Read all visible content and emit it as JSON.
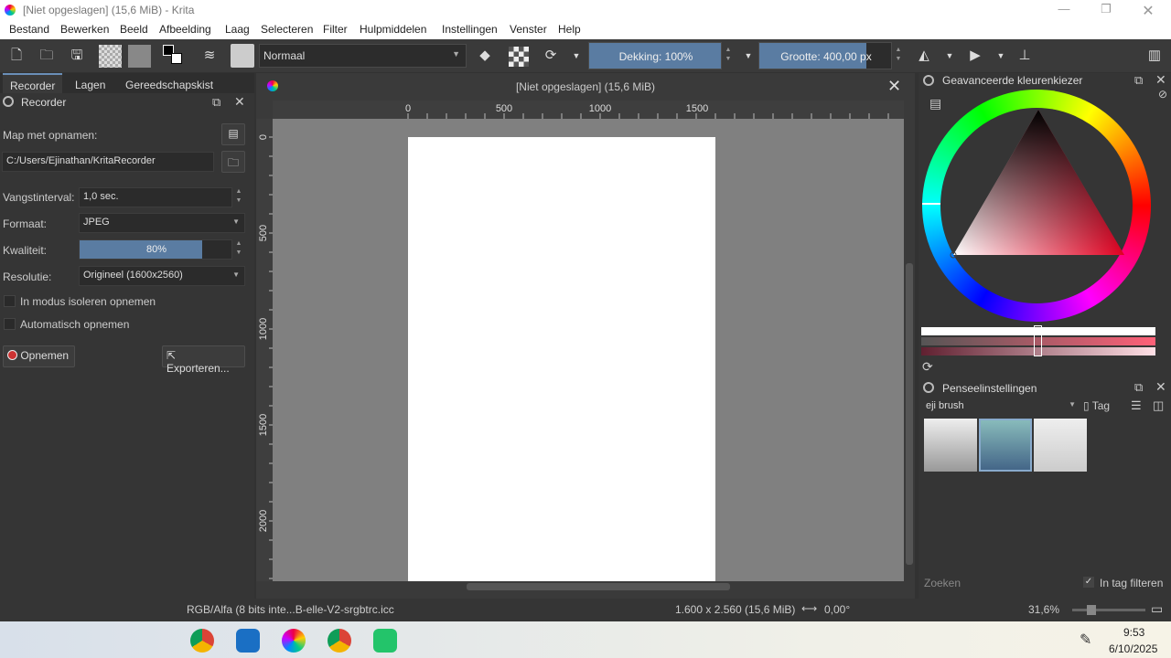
{
  "window": {
    "title": "[Niet opgeslagen]  (15,6 MiB)  - Krita"
  },
  "menu": [
    "Bestand",
    "Bewerken",
    "Beeld",
    "Afbeelding",
    "Laag",
    "Selecteren",
    "Filter",
    "Hulpmiddelen",
    "Instellingen",
    "Venster",
    "Help"
  ],
  "toolbar": {
    "blend_mode": "Normaal",
    "opacity": "Dekking: 100%",
    "opacity_fraction": 1.0,
    "size": "Grootte: 400,00 px",
    "size_fraction": 0.8
  },
  "left_docker": {
    "tabs": [
      "Recorder",
      "Lagen",
      "Gereedschapskist"
    ],
    "panel_title": "Recorder",
    "folder_label": "Map met opnamen:",
    "folder_value": "C:/Users/Ejinathan/KritaRecorder",
    "interval_label": "Vangstinterval:",
    "interval_value": "1,0 sec.",
    "format_label": "Formaat:",
    "format_value": "JPEG",
    "quality_label": "Kwaliteit:",
    "quality_value": "80%",
    "quality_fraction": 0.8,
    "resolution_label": "Resolutie:",
    "resolution_value": "Origineel (1600x2560)",
    "isolate_label": "In modus isoleren opnemen",
    "auto_label": "Automatisch opnemen",
    "record_button": "Opnemen",
    "export_button": "Exporteren..."
  },
  "canvas": {
    "tab_title": "[Niet opgeslagen]  (15,6 MiB)",
    "ruler_top": [
      "0",
      "500",
      "1000",
      "1500"
    ],
    "ruler_left": [
      "0",
      "500",
      "1000",
      "1500",
      "2000"
    ]
  },
  "right_docker": {
    "color_title": "Geavanceerde kleurenkiezer",
    "brush_title": "Penseelinstellingen",
    "brush_preset": "eji brush",
    "tag_label": "Tag",
    "search_placeholder": "Zoeken",
    "filter_label": "In tag filteren"
  },
  "status": {
    "color_profile": "RGB/Alfa (8 bits inte...B-elle-V2-srgbtrc.icc",
    "dimensions": "1.600 x 2.560 (15,6 MiB)",
    "rotation": "0,00°",
    "zoom": "31,6%"
  },
  "taskbar": {
    "time": "9:53",
    "date": "6/10/2025"
  },
  "icons": {
    "window": "krita-icon",
    "pen": "stylus-icon"
  }
}
